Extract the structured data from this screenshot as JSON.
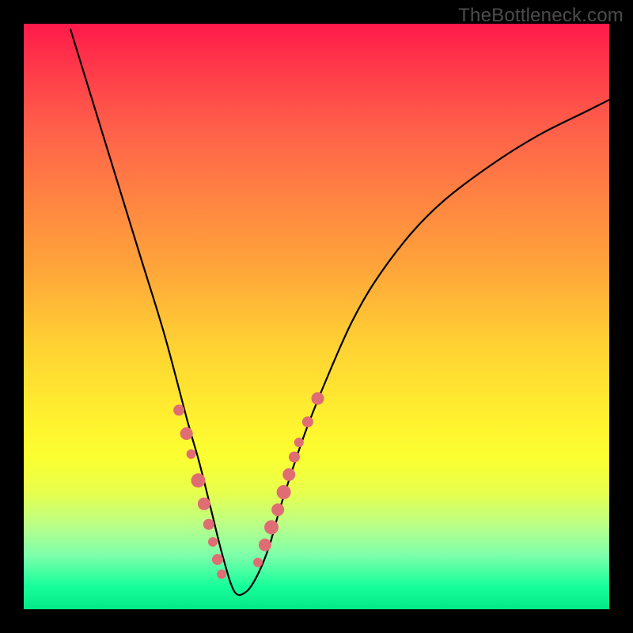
{
  "watermark": "TheBottleneck.com",
  "colors": {
    "frame": "#000000",
    "gradient_top": "#ff1a4b",
    "gradient_bottom": "#02e887",
    "curve": "#000000",
    "marker": "#e06d73"
  },
  "chart_data": {
    "type": "line",
    "title": "",
    "xlabel": "",
    "ylabel": "",
    "xlim": [
      0,
      100
    ],
    "ylim": [
      0,
      100
    ],
    "note": "No axis ticks or labels are rendered; values approximate the shape of a V-like bottleneck curve over a heat gradient. Minimum near x≈36, y≈2.",
    "x": [
      8,
      12,
      16,
      20,
      24,
      28,
      30,
      32,
      34,
      36,
      38,
      40,
      42,
      44,
      48,
      52,
      56,
      60,
      66,
      72,
      80,
      88,
      96,
      100
    ],
    "y": [
      99,
      86,
      73,
      60,
      47,
      32,
      25,
      17,
      9,
      3,
      3,
      6,
      11,
      18,
      30,
      40,
      49,
      56,
      64,
      70,
      76,
      81,
      85,
      87
    ],
    "markers_left": {
      "x": [
        26.5,
        27.8,
        28.6,
        29.8,
        30.8,
        31.6,
        32.3,
        33.1,
        33.8
      ],
      "y": [
        34.0,
        30.0,
        26.5,
        22.0,
        18.0,
        14.5,
        11.5,
        8.5,
        6.0
      ],
      "r": [
        7,
        8,
        6,
        9,
        8,
        7,
        6,
        7,
        6
      ]
    },
    "markers_right": {
      "x": [
        40.0,
        41.2,
        42.3,
        43.4,
        44.4,
        45.3,
        46.2,
        47.0,
        48.5,
        50.2
      ],
      "y": [
        8.0,
        11.0,
        14.0,
        17.0,
        20.0,
        23.0,
        26.0,
        28.5,
        32.0,
        36.0
      ],
      "r": [
        6,
        8,
        9,
        8,
        9,
        8,
        7,
        6,
        7,
        8
      ]
    }
  }
}
